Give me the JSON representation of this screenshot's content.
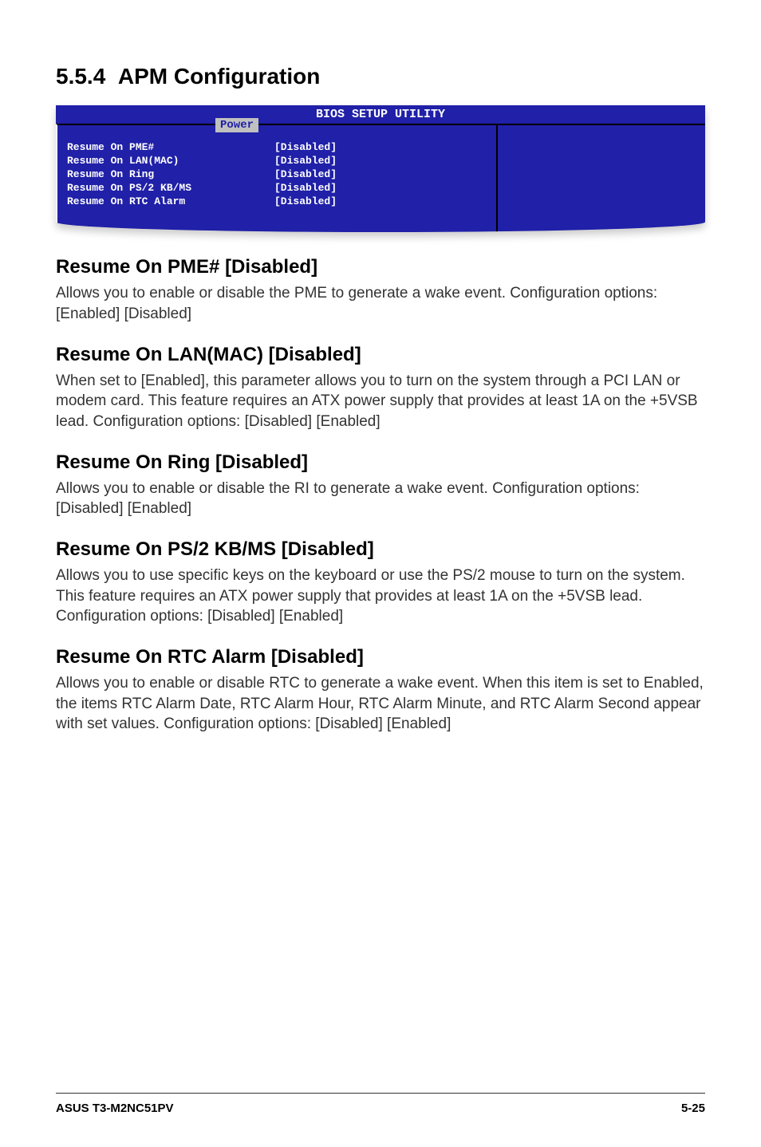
{
  "section": {
    "number": "5.5.4",
    "title": "APM Configuration"
  },
  "bios": {
    "header": "BIOS SETUP UTILITY",
    "tab": "Power",
    "rows": [
      {
        "label": "Resume On PME#",
        "value": "[Disabled]"
      },
      {
        "label": "Resume On LAN(MAC)",
        "value": "[Disabled]"
      },
      {
        "label": "Resume On Ring",
        "value": "[Disabled]"
      },
      {
        "label": "Resume On PS/2 KB/MS",
        "value": "[Disabled]"
      },
      {
        "label": "Resume On RTC Alarm",
        "value": "[Disabled]"
      }
    ]
  },
  "items": [
    {
      "heading": "Resume On PME# [Disabled]",
      "body": "Allows you to enable or disable the PME to generate a wake event. Configuration options: [Enabled] [Disabled]"
    },
    {
      "heading": "Resume On LAN(MAC) [Disabled]",
      "body": "When set to [Enabled], this parameter allows you to turn on the system through a PCI LAN or modem card. This feature requires an ATX power supply that provides at least 1A on the +5VSB lead. Configuration options: [Disabled] [Enabled]"
    },
    {
      "heading": "Resume On Ring [Disabled]",
      "body": "Allows you to enable or disable the RI to generate a wake event. Configuration options: [Disabled] [Enabled]"
    },
    {
      "heading": "Resume On PS/2 KB/MS [Disabled]",
      "body": "Allows you to use specific keys on the keyboard or use the PS/2 mouse to turn on the system. This feature requires an ATX power supply that provides at least 1A on the +5VSB lead. Configuration options: [Disabled] [Enabled]"
    },
    {
      "heading": "Resume On RTC Alarm [Disabled]",
      "body": "Allows you to enable or disable RTC to generate a wake event. When this item is set to Enabled, the items RTC Alarm Date, RTC Alarm Hour, RTC Alarm Minute, and RTC Alarm Second appear with set values. Configuration options: [Disabled] [Enabled]"
    }
  ],
  "footer": {
    "left": "ASUS T3-M2NC51PV",
    "right": "5-25"
  }
}
